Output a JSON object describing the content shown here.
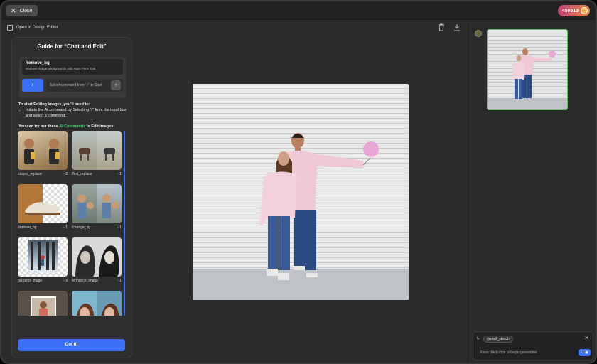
{
  "topbar": {
    "close_label": "Close",
    "credits": "450613"
  },
  "toolbar": {
    "design_editor_label": "Open in Design Editor"
  },
  "guide": {
    "title": "Guide for “Chat and Edit”",
    "suggest_name": "/remove_bg",
    "suggest_desc": "Remove image backgrounds with Appy Pie's Tool",
    "slash_label": "/",
    "input_placeholder": "Select command from ' / ' to Start",
    "instr_intro": "To start Editing images, you'll need to:",
    "instr_step": "Initiate the AI command by Selecting \"/\" from the input box and select a command.",
    "try_prefix": "You can try our these ",
    "try_ai": "AI Commands",
    "try_suffix": " to Edit images:",
    "cards": [
      {
        "label": "/object_replace",
        "cost": "- 2"
      },
      {
        "label": "/find_replace",
        "cost": "- 1"
      },
      {
        "label": "/remove_bg",
        "cost": "- 1"
      },
      {
        "label": "/change_bg",
        "cost": "- 1"
      },
      {
        "label": "/expand_image",
        "cost": "- 3"
      },
      {
        "label": "/enhance_image",
        "cost": "- 1"
      },
      {
        "label": "",
        "cost": ""
      },
      {
        "label": "",
        "cost": ""
      }
    ],
    "got_it": "Got it!"
  },
  "chat": {
    "chip": "/pencil_sketch",
    "placeholder": "Press the button to begin generation...",
    "send_cost": "-1"
  },
  "colors": {
    "accent": "#3b6ff5",
    "ai_green": "#4cc96a",
    "badge": "#c2407a"
  }
}
